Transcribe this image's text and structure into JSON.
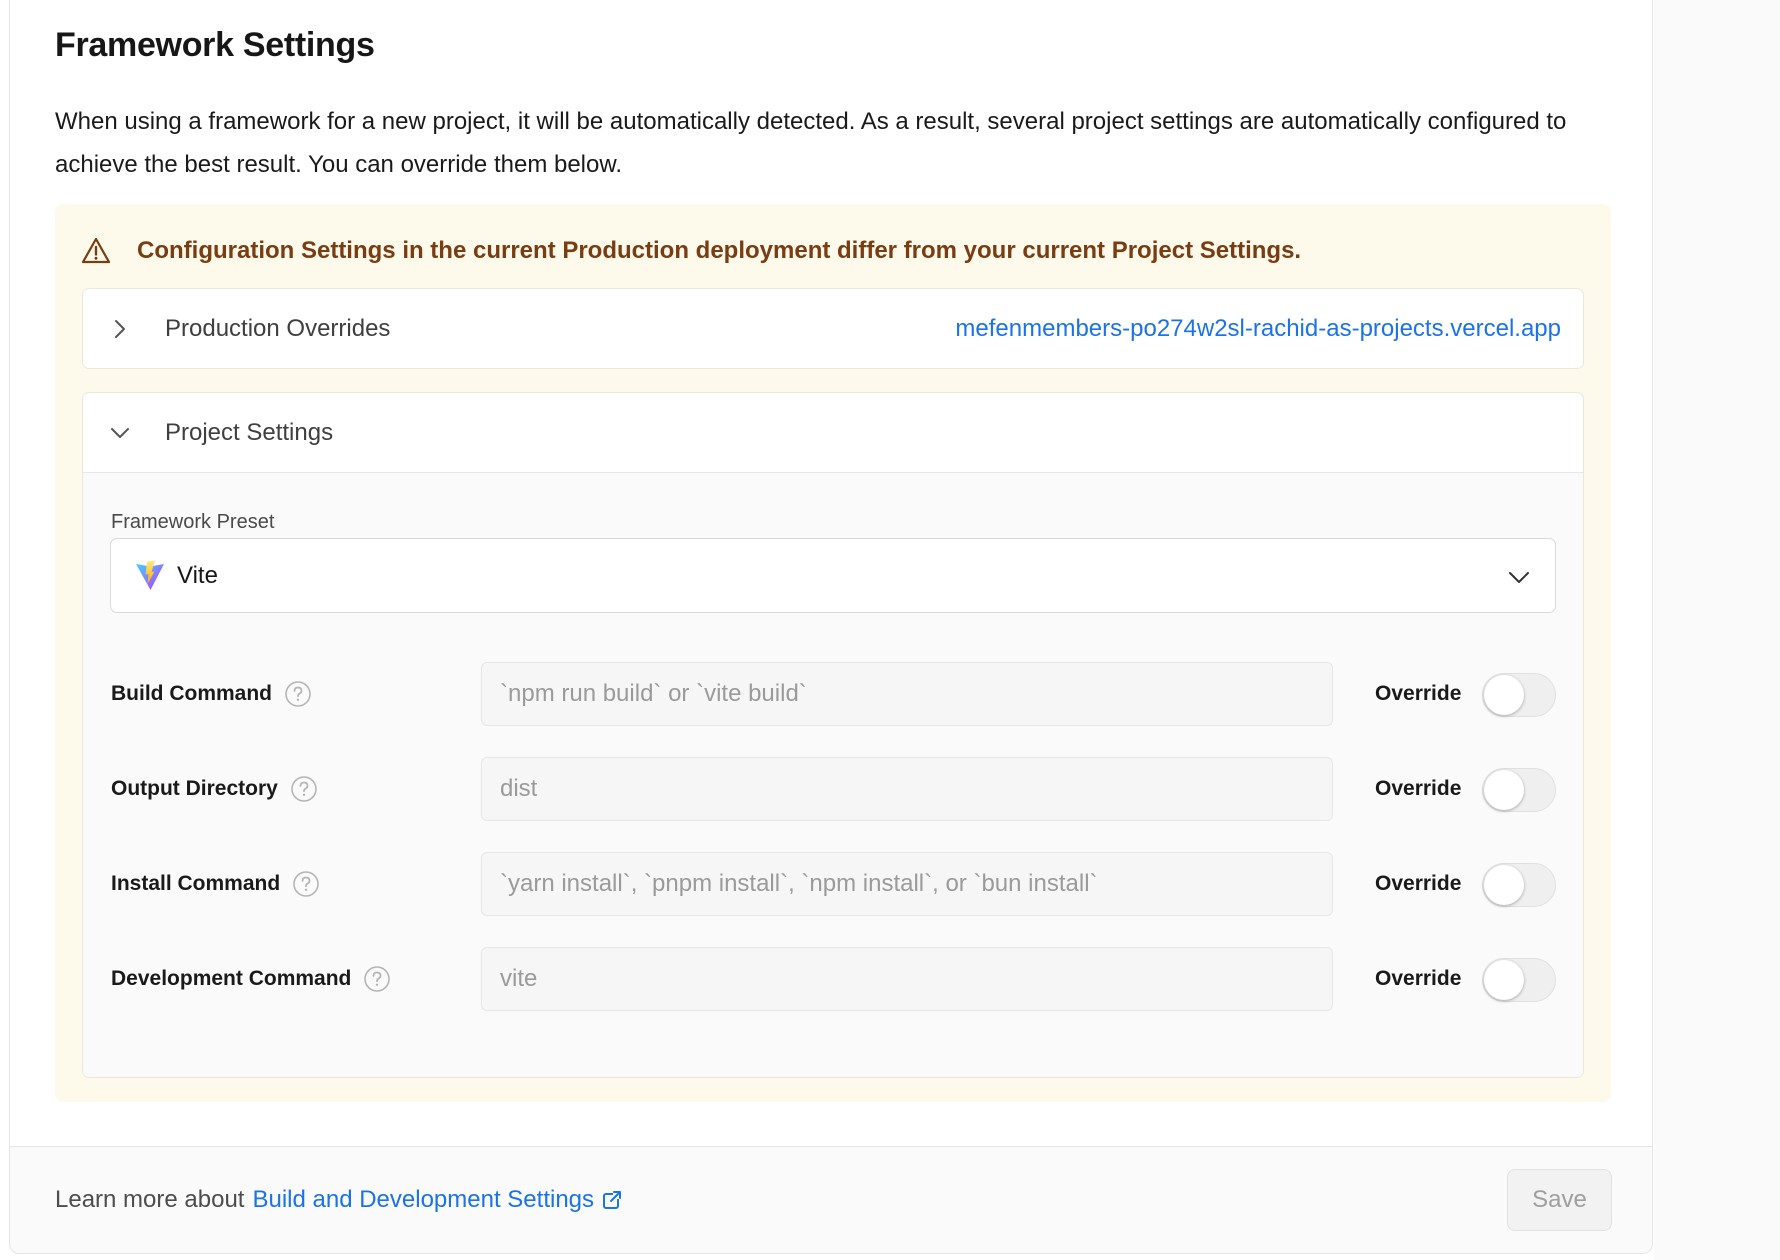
{
  "section": {
    "title": "Framework Settings",
    "description": "When using a framework for a new project, it will be automatically detected. As a result, several project settings are automatically configured to achieve the best result. You can override them below."
  },
  "warning": {
    "icon": "warning-triangle-icon",
    "text": "Configuration Settings in the current Production deployment differ from your current Project Settings.",
    "color": "#7a3c12",
    "background": "#fefaeb"
  },
  "production_overrides": {
    "label": "Production Overrides",
    "expanded": false,
    "link": "mefenmembers-po274w2sl-rachid-as-projects.vercel.app"
  },
  "project_settings": {
    "label": "Project Settings",
    "expanded": true,
    "framework_preset": {
      "label": "Framework Preset",
      "value": "Vite"
    },
    "rows": [
      {
        "label": "Build Command",
        "placeholder": "`npm run build` or `vite build`",
        "override_label": "Override",
        "override_on": false
      },
      {
        "label": "Output Directory",
        "placeholder": "dist",
        "override_label": "Override",
        "override_on": false
      },
      {
        "label": "Install Command",
        "placeholder": "`yarn install`, `pnpm install`, `npm install`, or `bun install`",
        "override_label": "Override",
        "override_on": false
      },
      {
        "label": "Development Command",
        "placeholder": "vite",
        "override_label": "Override",
        "override_on": false
      }
    ]
  },
  "footer": {
    "prefix": "Learn more about",
    "link": "Build and Development Settings",
    "save_label": "Save"
  },
  "colors": {
    "link": "#1a73e8",
    "accent_text": "#171717"
  }
}
